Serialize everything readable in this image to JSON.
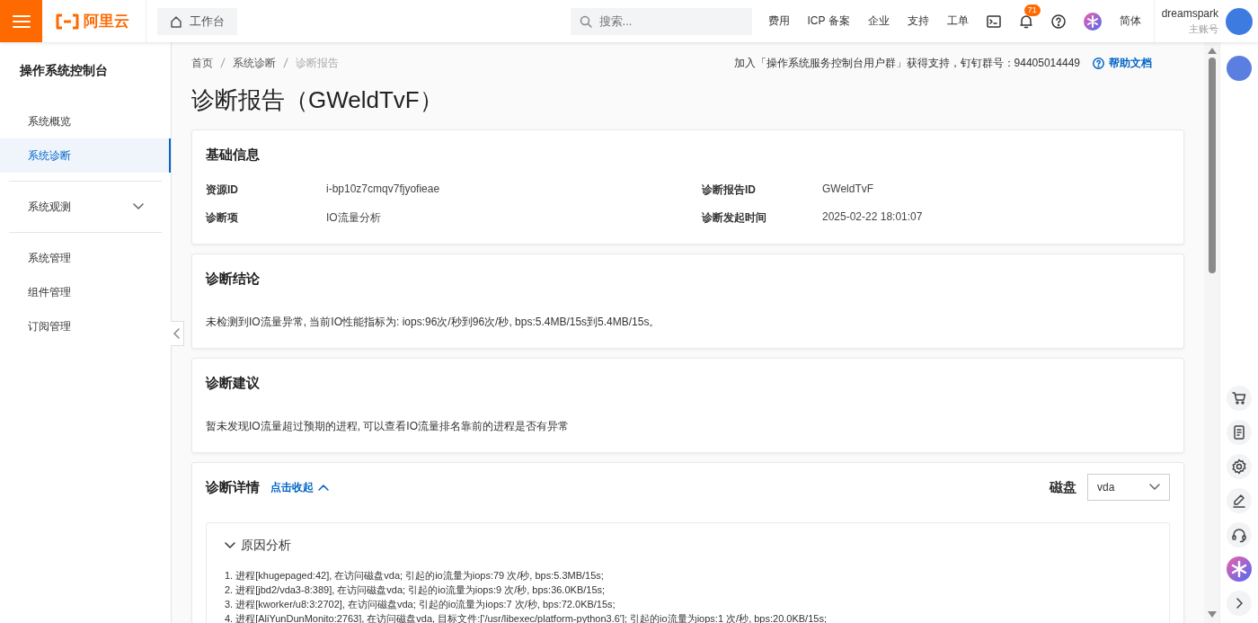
{
  "topbar": {
    "logo_text": "阿里云",
    "workbench": "工作台",
    "search": {
      "placeholder": "搜索..."
    },
    "nav_links": [
      "费用",
      "ICP 备案",
      "企业",
      "支持",
      "工单"
    ],
    "notification_count": "71",
    "language": "简体",
    "user": {
      "name": "dreamspark",
      "role": "主账号"
    }
  },
  "sidebar": {
    "title": "操作系统控制台",
    "groups": [
      {
        "items": [
          {
            "label": "系统概览",
            "selected": false
          },
          {
            "label": "系统诊断",
            "selected": true
          }
        ]
      },
      {
        "items": [
          {
            "label": "系统观测",
            "selected": false,
            "expanded": false
          }
        ]
      },
      {
        "items": [
          {
            "label": "系统管理",
            "selected": false
          },
          {
            "label": "组件管理",
            "selected": false
          },
          {
            "label": "订阅管理",
            "selected": false
          }
        ]
      }
    ]
  },
  "breadcrumb": [
    "首页",
    "系统诊断",
    "诊断报告"
  ],
  "support_note": "加入「操作系统服务控制台用户群」获得支持，钉钉群号：94405014449",
  "help_link": "帮助文档",
  "title": "诊断报告（GWeldTvF）",
  "basic_info": {
    "title": "基础信息",
    "fields": [
      {
        "label": "资源ID",
        "value": "i-bp10z7cmqv7fjyofieae"
      },
      {
        "label": "诊断报告ID",
        "value": "GWeldTvF"
      },
      {
        "label": "诊断项",
        "value": "IO流量分析"
      },
      {
        "label": "诊断发起时间",
        "value": "2025-02-22 18:01:07"
      }
    ]
  },
  "conclusion": {
    "title": "诊断结论",
    "text": "未检测到IO流量异常, 当前IO性能指标为: iops:96次/秒到96次/秒, bps:5.4MB/15s到5.4MB/15s。"
  },
  "suggestion": {
    "title": "诊断建议",
    "text": "暂未发现IO流量超过预期的进程, 可以查看IO流量排名靠前的进程是否有异常"
  },
  "details": {
    "title": "诊断详情",
    "toggle": "点击收起",
    "expanded": true,
    "disk_label": "磁盘",
    "disk_value": "vda",
    "panel": {
      "title": "原因分析",
      "expanded": true,
      "lines": [
        "1. 进程[khugepaged:42], 在访问磁盘vda; 引起的io流量为iops:79 次/秒, bps:5.3MB/15s;",
        "2. 进程[jbd2/vda3-8:389], 在访问磁盘vda; 引起的io流量为iops:9 次/秒, bps:36.0KB/15s;",
        "3. 进程[kworker/u8:3:2702], 在访问磁盘vda; 引起的io流量为iops:7 次/秒, bps:72.0KB/15s;",
        "4. 进程[AliYunDunMonito:2763], 在访问磁盘vda, 目标文件:['/usr/libexec/platform-python3.6']; 引起的io流量为iops:1 次/秒, bps:20.0KB/15s;"
      ]
    }
  }
}
